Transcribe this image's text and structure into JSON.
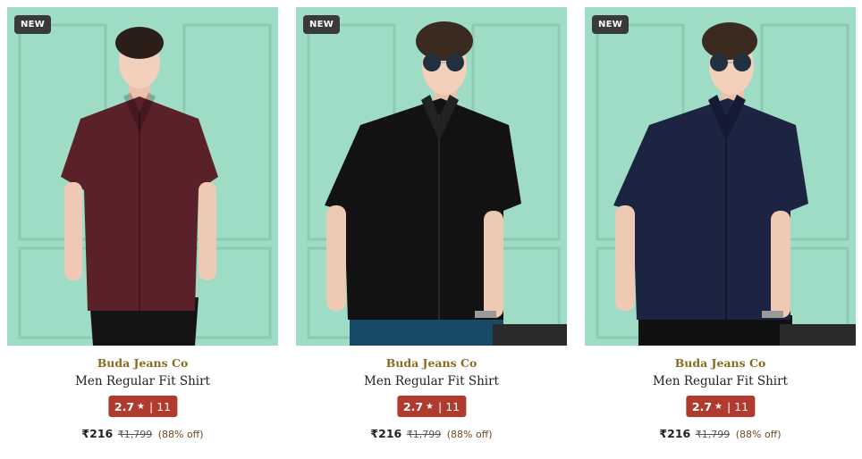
{
  "products": [
    {
      "badge": "NEW",
      "brand": "Buda Jeans Co",
      "name": "Men Regular Fit Shirt",
      "rating": "2.7",
      "reviews": "11",
      "price": "₹216",
      "mrp": "₹1,799",
      "discount": "(88% off)",
      "shirt_color": "#5a2129",
      "pants_color": "#141414"
    },
    {
      "badge": "NEW",
      "brand": "Buda Jeans Co",
      "name": "Men Regular Fit Shirt",
      "rating": "2.7",
      "reviews": "11",
      "price": "₹216",
      "mrp": "₹1,799",
      "discount": "(88% off)",
      "shirt_color": "#121212",
      "pants_color": "#174a66"
    },
    {
      "badge": "NEW",
      "brand": "Buda Jeans Co",
      "name": "Men Regular Fit Shirt",
      "rating": "2.7",
      "reviews": "11",
      "price": "₹216",
      "mrp": "₹1,799",
      "discount": "(88% off)",
      "shirt_color": "#1c2442",
      "pants_color": "#111111"
    }
  ],
  "colors": {
    "background_wall": "#9fdcc5",
    "brand_text": "#8a6a1f",
    "rating_badge": "#b03a2e",
    "new_badge": "#3a3a3a"
  },
  "icons": {
    "rating_star": "star-icon"
  }
}
